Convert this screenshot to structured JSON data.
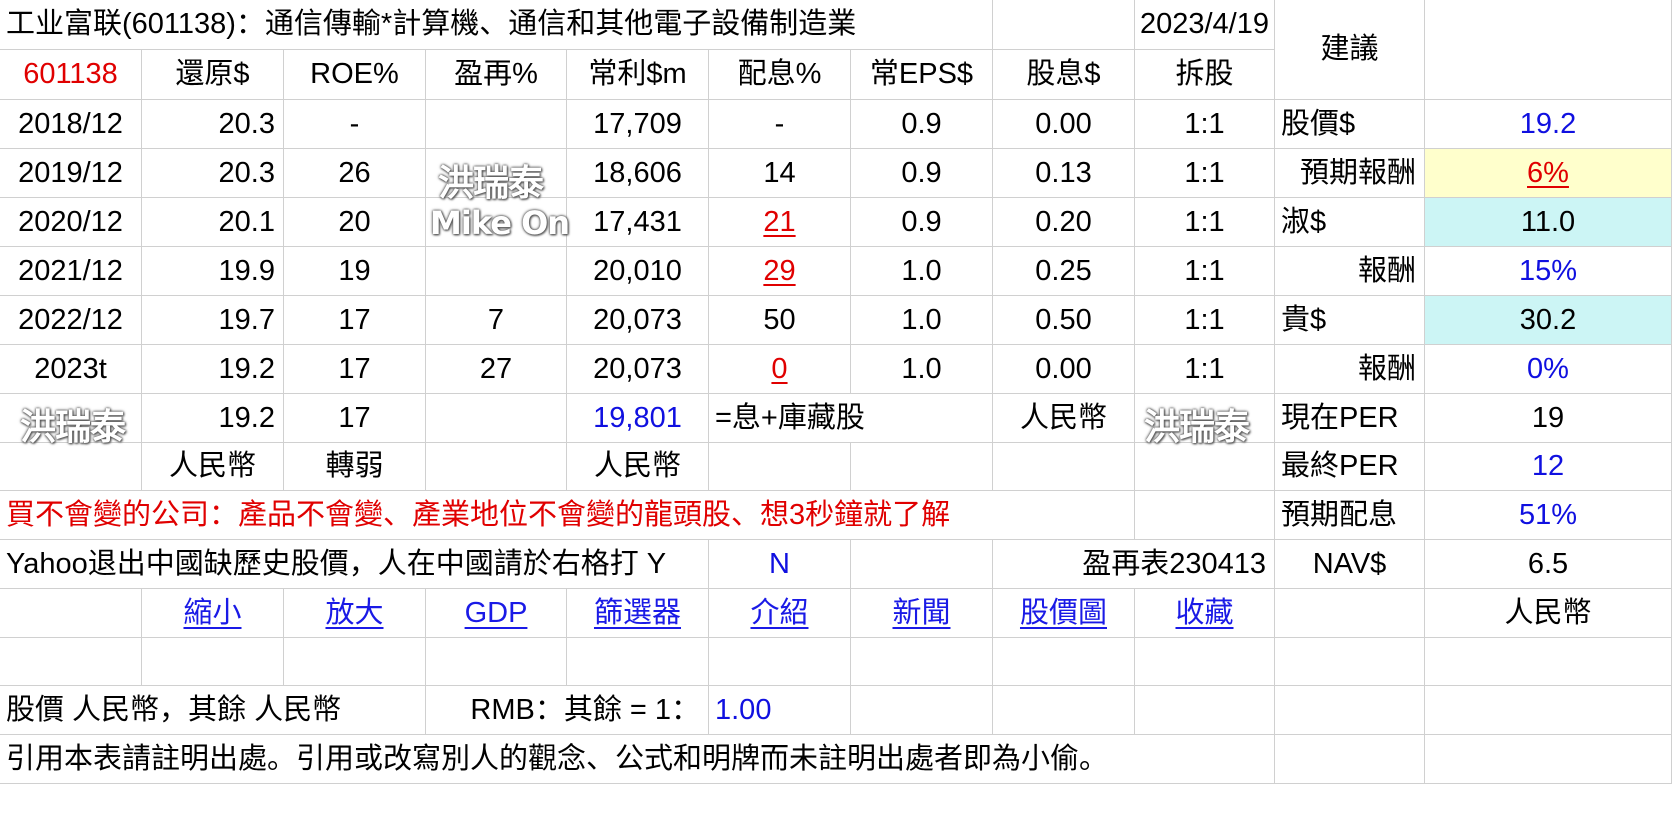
{
  "title": "工业富联(601138)：通信傳輸*計算機、通信和其他電子設備制造業",
  "date": "2023/4/19",
  "advice_header": "建議",
  "header_row": [
    "601138",
    "還原$",
    "ROE%",
    "盈再%",
    "常利$m",
    "配息%",
    "常EPS$",
    "股息$",
    "拆股"
  ],
  "rows": [
    [
      "2018/12",
      "20.3",
      "-",
      "",
      "17,709",
      "-",
      "0.9",
      "0.00",
      "1:1"
    ],
    [
      "2019/12",
      "20.3",
      "26",
      "",
      "18,606",
      "14",
      "0.9",
      "0.13",
      "1:1"
    ],
    [
      "2020/12",
      "20.1",
      "20",
      "",
      "17,431",
      "21",
      "0.9",
      "0.20",
      "1:1"
    ],
    [
      "2021/12",
      "19.9",
      "19",
      "",
      "20,010",
      "29",
      "1.0",
      "0.25",
      "1:1"
    ],
    [
      "2022/12",
      "19.7",
      "17",
      "7",
      "20,073",
      "50",
      "1.0",
      "0.50",
      "1:1"
    ],
    [
      "2023t",
      "19.2",
      "17",
      "27",
      "20,073",
      "0",
      "1.0",
      "0.00",
      "1:1"
    ]
  ],
  "summary_row": {
    "restored": "19.2",
    "roe": "17",
    "profit": "19,801",
    "note": "=息+庫藏股",
    "currency": "人民幣"
  },
  "unit_row": {
    "restored": "人民幣",
    "roe": "轉弱",
    "profit": "人民幣"
  },
  "side_panel": [
    {
      "label": "股價$",
      "value": "19.2"
    },
    {
      "label": "預期報酬",
      "value": "6%"
    },
    {
      "label": "淑$",
      "value": "11.0"
    },
    {
      "label": "報酬",
      "value": "15%"
    },
    {
      "label": "貴$",
      "value": "30.2"
    },
    {
      "label": "報酬",
      "value": "0%"
    },
    {
      "label": "現在PER",
      "value": "19"
    },
    {
      "label": "最終PER",
      "value": "12"
    },
    {
      "label": "預期配息",
      "value": "51%"
    },
    {
      "label": "NAV$",
      "value": "6.5"
    },
    {
      "label": "",
      "value": "人民幣"
    }
  ],
  "slogan": "買不會變的公司：產品不會變、產業地位不會變的龍頭股、想3秒鐘就了解",
  "yahoo_note": "Yahoo退出中國缺歷史股價，人在中國請於右格打 Y",
  "yahoo_value": "N",
  "report_ref": "盈再表230413",
  "links": [
    "縮小",
    "放大",
    "GDP",
    "篩選器",
    "介紹",
    "新聞",
    "股價圖",
    "收藏"
  ],
  "fx_note": "股價 人民幣，其餘 人民幣",
  "fx_label": "RMB：其餘 = 1：",
  "fx_value": "1.00",
  "footer": "引用本表請註明出處。引用或改寫別人的觀念、公式和明牌而未註明出處者即為小偷。",
  "watermark_cn": "洪瑞泰",
  "watermark_en": "Mike On",
  "colors": {
    "red": "#e00000",
    "blue": "#1010e0",
    "yellow_fill": "#ffffcc",
    "cyan_fill": "#ccf5f5",
    "grid": "#d0d0d0"
  }
}
